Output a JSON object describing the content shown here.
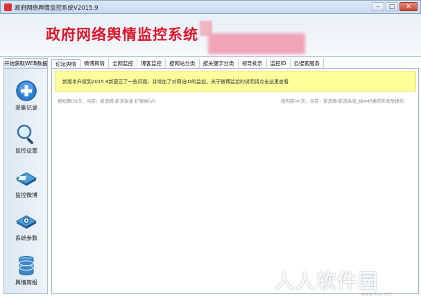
{
  "window": {
    "title": "政府网络舆情监控系统V2015.9",
    "min_label": "–",
    "max_label": "□",
    "close_label": "✕"
  },
  "banner": {
    "brand": "政府网络舆情监控系统",
    "brand_color": "#d8142a"
  },
  "sidebar": {
    "header": "开始获取WEB数据",
    "items": [
      {
        "label": "采集记录",
        "icon": "plus-circle-icon"
      },
      {
        "label": "监控设置",
        "icon": "magnifier-icon"
      },
      {
        "label": "监控微博",
        "icon": "microblog-icon"
      },
      {
        "label": "系统参数",
        "icon": "settings-icon"
      },
      {
        "label": "舆情简报",
        "icon": "database-icon"
      }
    ]
  },
  "tabs": [
    {
      "label": "论坛舆情",
      "active": true
    },
    {
      "label": "微博舆情"
    },
    {
      "label": "全网监控"
    },
    {
      "label": "博客监控"
    },
    {
      "label": "按网站分类"
    },
    {
      "label": "按关键字分类"
    },
    {
      "label": "领导批示"
    },
    {
      "label": "监控ID"
    },
    {
      "label": "云搜索服务"
    }
  ],
  "content": {
    "notice": "新版本升级到2015.9新更正了一些问题，并增加了对网站ID的监控。关于微博监控的说明请点击这里查看",
    "status_left": "搜标题(0)次，当前：新浪网-新浪杂谈 扩展帧0/0",
    "status_right": "搜内容(4)次，当前：新浪网-新浪杂谈_给中纪委的实名举报信"
  },
  "watermark": {
    "text": "人人软件园",
    "url": "www.kkx.net"
  }
}
